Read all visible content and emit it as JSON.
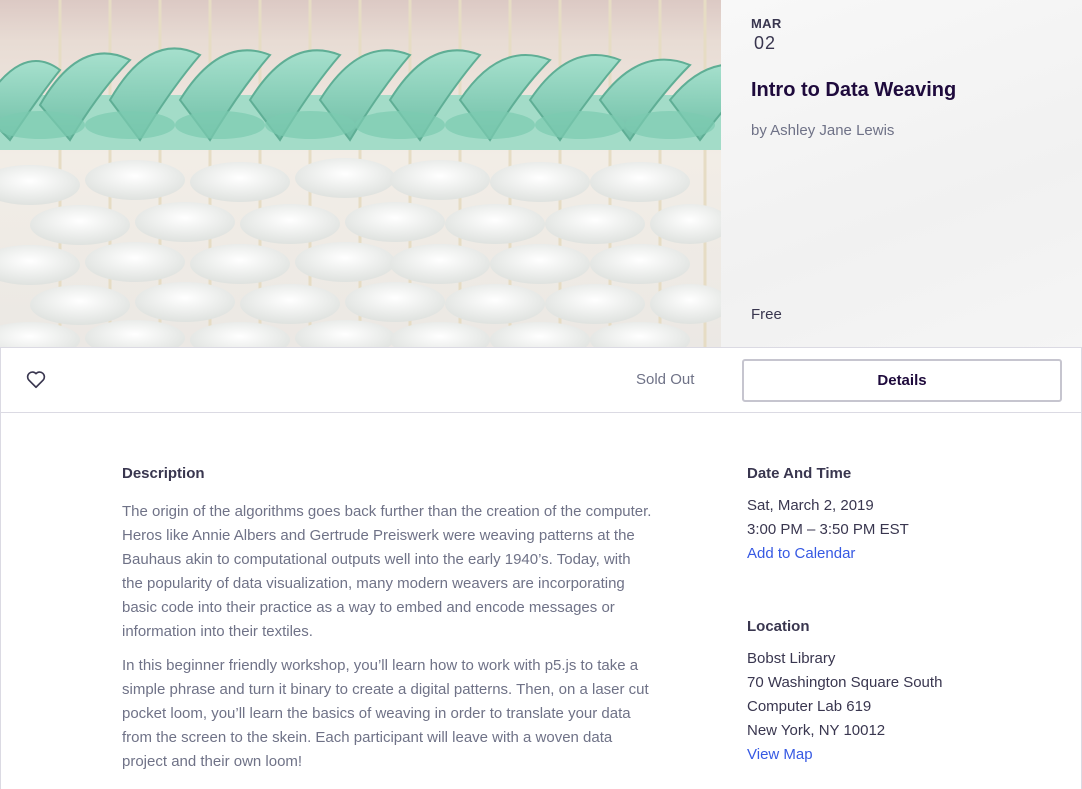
{
  "event": {
    "month": "MAR",
    "day": "02",
    "title": "Intro to Data Weaving",
    "organizer": "by Ashley Jane Lewis",
    "price": "Free"
  },
  "actions": {
    "favorite_icon": "heart-outline-icon",
    "status": "Sold Out",
    "details_label": "Details"
  },
  "description": {
    "heading": "Description",
    "paragraphs": [
      "The origin of the algorithms goes back further than the creation of the computer. Heros like Annie Albers and Gertrude Preiswerk were weaving patterns at the Bauhaus akin to computational outputs well into the early 1940’s. Today, with the popularity of data visualization, many modern weavers are incorporating basic code into their practice as a way to embed and encode messages or information into their textiles.",
      "In this beginner friendly workshop, you’ll learn how to work with p5.js to take a simple phrase and turn it binary to create a digital patterns. Then, on a laser cut pocket loom, you’ll learn the basics of weaving in order to translate your data from the screen to the skein. Each participant will leave with a woven data project and their own loom!"
    ]
  },
  "date_time": {
    "heading": "Date And Time",
    "date": "Sat, March 2, 2019",
    "time": "3:00 PM – 3:50 PM EST",
    "add_to_calendar": "Add to Calendar"
  },
  "location": {
    "heading": "Location",
    "venue": "Bobst Library",
    "address1": "70 Washington Square South",
    "address2": "Computer Lab 619",
    "city": "New York, NY 10012",
    "view_map": "View Map"
  },
  "colors": {
    "title": "#1e0a3c",
    "link": "#3659e3",
    "yarn_teal": "#8fd3bd",
    "yarn_white": "#f4f5f4"
  }
}
